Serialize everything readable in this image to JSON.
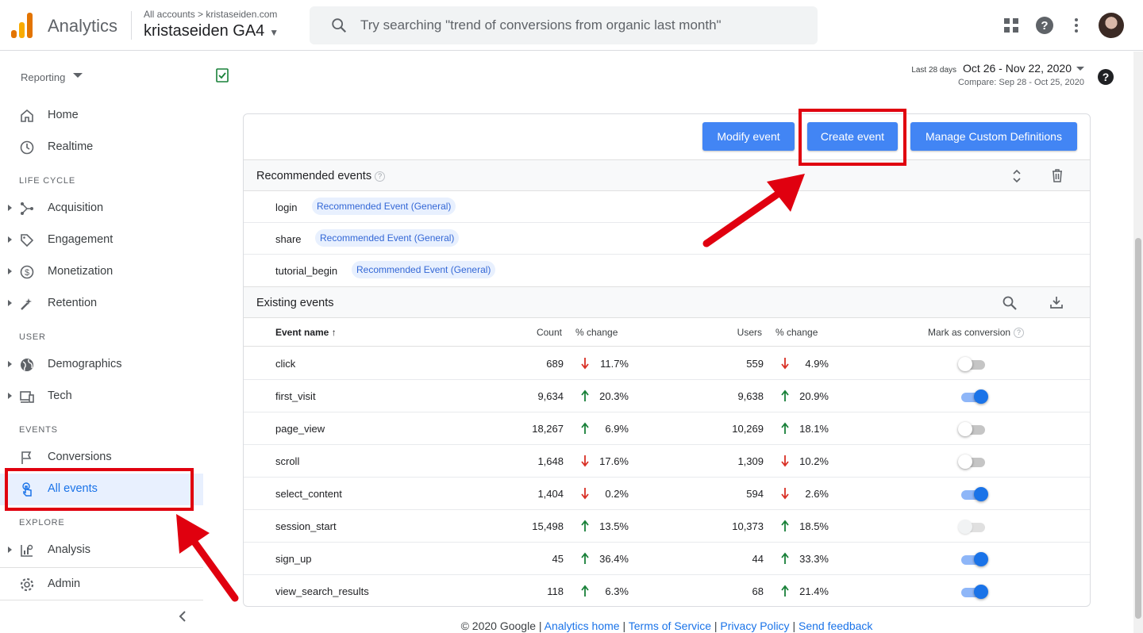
{
  "header": {
    "brand": "Analytics",
    "account_crumb": "All accounts > kristaseiden.com",
    "property": "kristaseiden GA4",
    "search_placeholder": "Try searching \"trend of conversions from organic last month\""
  },
  "sidebar": {
    "reporting_label": "Reporting",
    "top_items": [
      {
        "label": "Home",
        "icon": "home-icon"
      },
      {
        "label": "Realtime",
        "icon": "clock-icon"
      }
    ],
    "sections": {
      "life_cycle": "LIFE CYCLE",
      "user": "USER",
      "events": "EVENTS",
      "explore": "EXPLORE"
    },
    "life_cycle_items": [
      {
        "label": "Acquisition",
        "icon": "acquisition-icon"
      },
      {
        "label": "Engagement",
        "icon": "tag-icon"
      },
      {
        "label": "Monetization",
        "icon": "dollar-icon"
      },
      {
        "label": "Retention",
        "icon": "retention-icon"
      }
    ],
    "user_items": [
      {
        "label": "Demographics",
        "icon": "globe-icon"
      },
      {
        "label": "Tech",
        "icon": "devices-icon"
      }
    ],
    "events_items": [
      {
        "label": "Conversions",
        "icon": "flag-icon"
      },
      {
        "label": "All events",
        "icon": "touch-icon",
        "active": true
      }
    ],
    "explore_items": [
      {
        "label": "Analysis",
        "icon": "analysis-icon"
      }
    ],
    "admin_label": "Admin"
  },
  "date": {
    "label": "Last 28 days",
    "range": "Oct 26 - Nov 22, 2020",
    "compare": "Compare: Sep 28 - Oct 25, 2020"
  },
  "toolbar": {
    "modify": "Modify event",
    "create": "Create event",
    "manage": "Manage Custom Definitions"
  },
  "recommended": {
    "title": "Recommended events",
    "items": [
      {
        "name": "login",
        "chip": "Recommended Event (General)"
      },
      {
        "name": "share",
        "chip": "Recommended Event (General)"
      },
      {
        "name": "tutorial_begin",
        "chip": "Recommended Event (General)"
      }
    ]
  },
  "existing": {
    "title": "Existing events",
    "columns": {
      "event_name": "Event name",
      "count": "Count",
      "count_change": "% change",
      "users": "Users",
      "users_change": "% change",
      "conversion": "Mark as conversion"
    },
    "rows": [
      {
        "name": "click",
        "count": "689",
        "count_change": "11.7%",
        "count_dir": "down",
        "users": "559",
        "users_change": "4.9%",
        "users_dir": "down",
        "conversion": "off"
      },
      {
        "name": "first_visit",
        "count": "9,634",
        "count_change": "20.3%",
        "count_dir": "up",
        "users": "9,638",
        "users_change": "20.9%",
        "users_dir": "up",
        "conversion": "on"
      },
      {
        "name": "page_view",
        "count": "18,267",
        "count_change": "6.9%",
        "count_dir": "up",
        "users": "10,269",
        "users_change": "18.1%",
        "users_dir": "up",
        "conversion": "off"
      },
      {
        "name": "scroll",
        "count": "1,648",
        "count_change": "17.6%",
        "count_dir": "down",
        "users": "1,309",
        "users_change": "10.2%",
        "users_dir": "down",
        "conversion": "off"
      },
      {
        "name": "select_content",
        "count": "1,404",
        "count_change": "0.2%",
        "count_dir": "down",
        "users": "594",
        "users_change": "2.6%",
        "users_dir": "down",
        "conversion": "on"
      },
      {
        "name": "session_start",
        "count": "15,498",
        "count_change": "13.5%",
        "count_dir": "up",
        "users": "10,373",
        "users_change": "18.5%",
        "users_dir": "up",
        "conversion": "disabled"
      },
      {
        "name": "sign_up",
        "count": "45",
        "count_change": "36.4%",
        "count_dir": "up",
        "users": "44",
        "users_change": "33.3%",
        "users_dir": "up",
        "conversion": "on"
      },
      {
        "name": "view_search_results",
        "count": "118",
        "count_change": "6.3%",
        "count_dir": "up",
        "users": "68",
        "users_change": "21.4%",
        "users_dir": "up",
        "conversion": "on"
      }
    ]
  },
  "footer": {
    "copyright": "© 2020 Google",
    "links": [
      "Analytics home",
      "Terms of Service",
      "Privacy Policy",
      "Send feedback"
    ]
  },
  "colors": {
    "accent": "#1a73e8",
    "button": "#4285f4",
    "up": "#188038",
    "down": "#d93025",
    "annotation": "#e0000f"
  }
}
